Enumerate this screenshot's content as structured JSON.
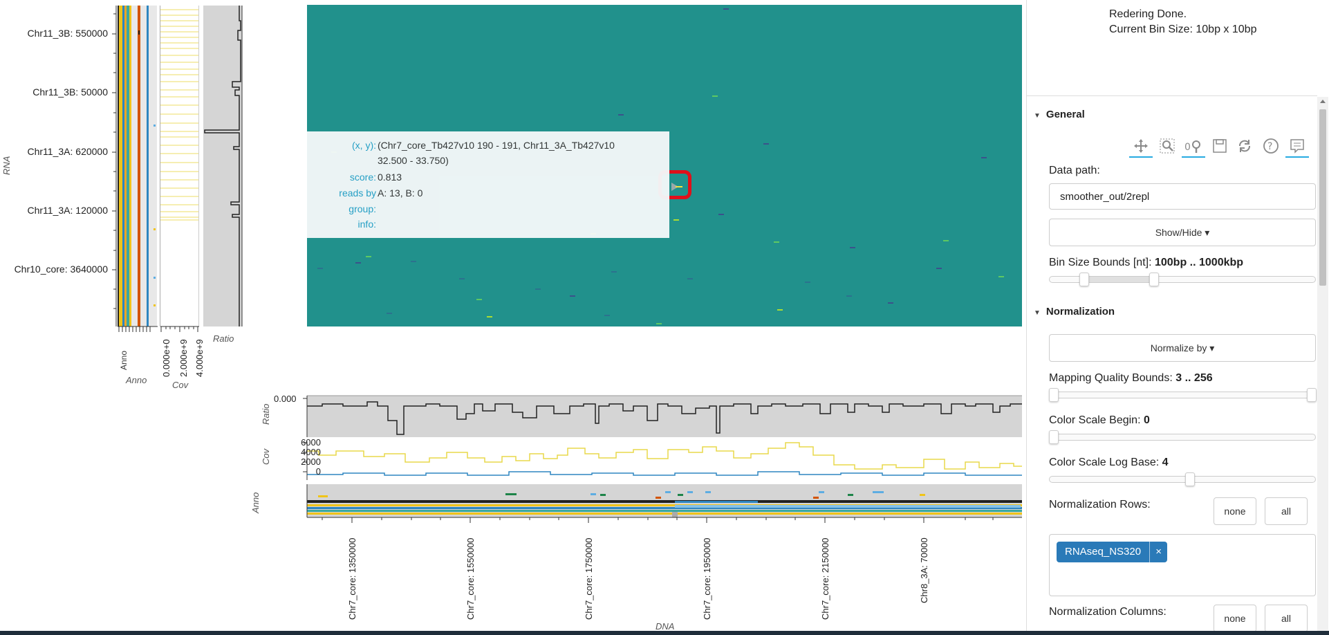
{
  "status": {
    "line1": "Redering Done.",
    "line2": "Current Bin Size: 10bp x 10bp"
  },
  "left_axis": {
    "title": "RNA",
    "ticks": [
      "Chr11_3B: 550000",
      "Chr11_3B: 50000",
      "Chr11_3A: 620000",
      "Chr11_3A: 120000",
      "Chr10_core: 3640000"
    ]
  },
  "side_tracks": {
    "anno_label": "Anno",
    "cov_label": "Cov",
    "ratio_label": "Ratio",
    "cov_ticks": [
      "0.000e+0",
      "2.000e+9",
      "4.000e+9"
    ]
  },
  "tooltip": {
    "xy_key": "(x, y):",
    "xy_val_line1": "(Chr7_core_Tb427v10 190 - 191, Chr11_3A_Tb427v10",
    "xy_val_line2": "32.500 - 33.750)",
    "score_key": "score:",
    "score_val": "0.813",
    "reads_key": "reads by",
    "reads_val": "A: 13, B: 0",
    "group_key": "group:",
    "info_key": "info:"
  },
  "bottom_tracks": {
    "ratio_label": "Ratio",
    "ratio_tick": "0.000",
    "cov_label": "Cov",
    "cov_ticks": [
      "6000",
      "4000",
      "2000",
      "0"
    ],
    "anno_label": "Anno",
    "x_title": "DNA",
    "x_ticks": [
      "Chr7_core: 1350000",
      "Chr7_core: 1550000",
      "Chr7_core: 1750000",
      "Chr7_core: 1950000",
      "Chr7_core: 2150000",
      "Chr8_3A: 70000"
    ]
  },
  "colors": {
    "heatmap_bg": "#21918c",
    "accent": "#26aae1",
    "tag_bg": "#2a7ab8",
    "cov_yellow": "#e8d84a",
    "cov_blue": "#2e86c1",
    "highlight_red": "#e0101a"
  },
  "panel": {
    "general_title": "General",
    "toolbar_icons": [
      "pan-icon",
      "box-zoom-icon",
      "wheel-zoom-icon",
      "save-icon",
      "reset-icon",
      "help-icon",
      "hover-icon"
    ],
    "data_path_label": "Data path:",
    "data_path_value": "smoother_out/2repl",
    "show_hide": "Show/Hide",
    "bin_bounds_label": "Bin Size Bounds [nt]:",
    "bin_bounds_value": "100bp .. 1000kbp",
    "normalization_title": "Normalization",
    "normalize_by": "Normalize by",
    "mapq_label": "Mapping Quality Bounds:",
    "mapq_value": "3 .. 256",
    "color_begin_label": "Color Scale Begin:",
    "color_begin_value": "0",
    "log_base_label": "Color Scale Log Base:",
    "log_base_value": "4",
    "norm_rows_label": "Normalization Rows:",
    "none_btn": "none",
    "all_btn": "all",
    "tag_value": "RNAseq_NS320",
    "tag_close": "×",
    "norm_cols_label": "Normalization Columns:"
  }
}
